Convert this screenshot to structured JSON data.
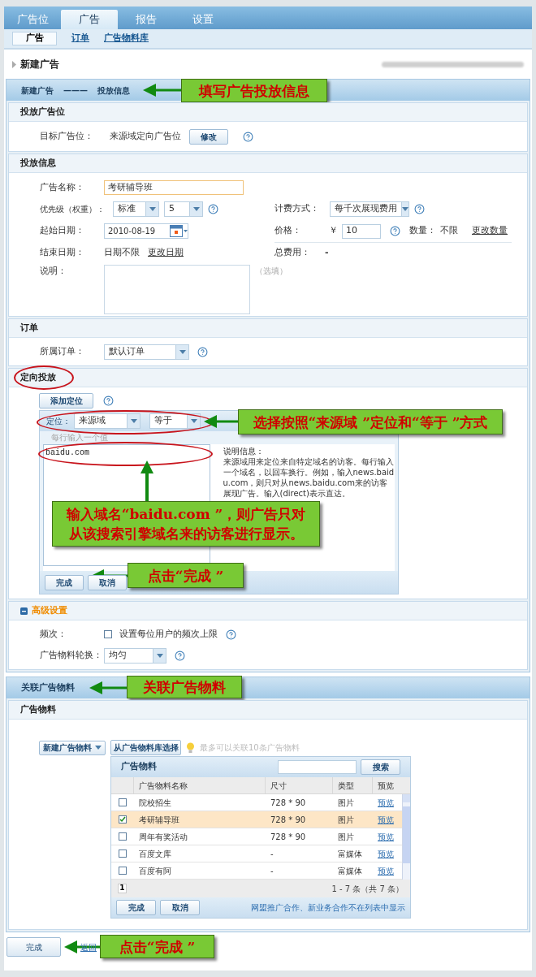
{
  "tabs": [
    {
      "label": "广告位",
      "selected": false
    },
    {
      "label": "广告",
      "selected": true
    },
    {
      "label": "报告",
      "selected": false
    },
    {
      "label": "设置",
      "selected": false
    }
  ],
  "subtabs": [
    {
      "label": "广告",
      "selected": true
    },
    {
      "label": "订单",
      "selected": false
    },
    {
      "label": "广告物料库",
      "selected": false
    }
  ],
  "page_title": "新建广告",
  "step_bar": {
    "parts": [
      "新建广告",
      "———",
      "投放信息"
    ],
    "callout": "填写广告投放信息"
  },
  "placement": {
    "title": "投放广告位",
    "label": "目标广告位：",
    "value": "来源域定向广告位",
    "button": "修改"
  },
  "info": {
    "title": "投放信息",
    "name_label": "广告名称：",
    "name_value": "考研辅导班",
    "priority_label": "优先级（权重）：",
    "priority_select": "标准",
    "weight_select": "5",
    "billing_label": "计费方式：",
    "billing_select": "每千次展现费用",
    "start_label": "起始日期：",
    "start_value": "2010-08-19",
    "price_label": "价格：",
    "currency": "￥",
    "price_value": "10",
    "qty_label": "数量：",
    "qty_value": "不限",
    "qty_link": "更改数量",
    "end_label": "结束日期：",
    "end_value": "日期不限",
    "end_link": "更改日期",
    "total_label": "总费用：",
    "total_value": "-",
    "note_label": "说明：",
    "note_hint": "（选填）"
  },
  "order": {
    "title": "订单",
    "label": "所属订单：",
    "select": "默认订单"
  },
  "targeting": {
    "title": "定向投放",
    "add_button": "添加定位",
    "type_label": "定位：",
    "type_select": "来源域",
    "operator_select": "等于",
    "hint": "每行输入一个值",
    "value": "baidu.com",
    "help_title": "说明信息：",
    "help_text": "来源域用来定位来自特定域名的访客。每行输入一个域名，以回车换行。例如，输入news.baidu.com，则只对从news.baidu.com来的访客展现广告。输入(direct)表示直达。",
    "done": "完成",
    "cancel": "取消",
    "rule_callout": "选择按照“来源域 ”定位和“等于 ”方式",
    "input_callout": "输入域名“baidu.com ”，则广告只对从该搜索引擎域名来的访客进行显示。",
    "done_callout": "点击“完成 ”"
  },
  "advanced": {
    "title": "高级设置",
    "expanded": true,
    "freq_label": "频次：",
    "frequency": {
      "label": "设置每位用户的频次上限",
      "checked": false
    },
    "rotate_label": "广告物料轮换：",
    "rotate_select": "均匀"
  },
  "materials_bar": {
    "title": "关联广告物料",
    "callout": "关联广告物料"
  },
  "materials": {
    "title": "广告物料",
    "new_button": "新建广告物料",
    "library_button": "从广告物料库选择",
    "tip": "最多可以关联10条广告物料",
    "panel": {
      "title": "广告物料",
      "search_button": "搜索",
      "columns": [
        "广告物料名称",
        "尺寸",
        "类型",
        "预览"
      ],
      "rows": [
        {
          "name": "院校招生",
          "size": "728 * 90",
          "type": "图片",
          "preview": "预览",
          "checked": false,
          "selected": false
        },
        {
          "name": "考研辅导班",
          "size": "728 * 90",
          "type": "图片",
          "preview": "预览",
          "checked": true,
          "selected": true
        },
        {
          "name": "周年有奖活动",
          "size": "728 * 90",
          "type": "图片",
          "preview": "预览",
          "checked": false,
          "selected": false
        },
        {
          "name": "百度文库",
          "size": "-",
          "type": "富媒体",
          "preview": "预览",
          "checked": false,
          "selected": false
        },
        {
          "name": "百度有阿",
          "size": "-",
          "type": "富媒体",
          "preview": "预览",
          "checked": false,
          "selected": false
        }
      ],
      "page": "1",
      "summary": "1 - 7 条（共 7 条）",
      "done": "完成",
      "cancel": "取消",
      "note": "网盟推广合作、新业务合作不在列表中显示"
    }
  },
  "footer": {
    "done": "完成",
    "back": "返回",
    "callout": "点击“完成 ”"
  }
}
